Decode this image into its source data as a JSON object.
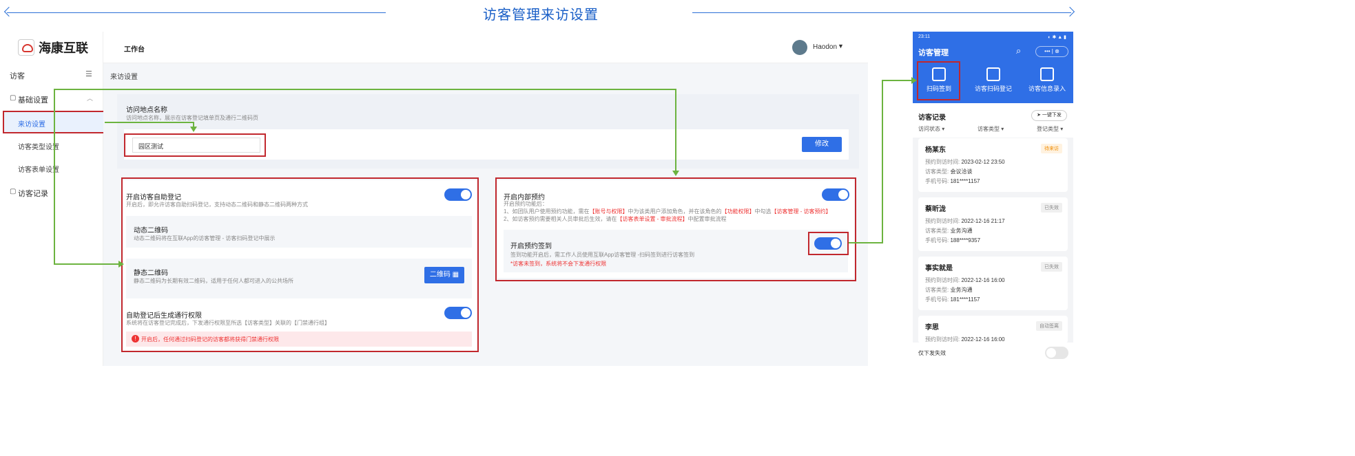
{
  "banner": {
    "title": "访客管理来访设置"
  },
  "sidebar": {
    "brand": "海康互联",
    "section_title": "访客",
    "groups": [
      {
        "label": "基础设置"
      },
      {
        "label": "访客记录"
      }
    ],
    "items": [
      {
        "label": "来访设置"
      },
      {
        "label": "访客类型设置"
      },
      {
        "label": "访客表单设置"
      }
    ]
  },
  "topbar": {
    "title": "工作台",
    "user": "Haodon"
  },
  "breadcrumb": "来访设置",
  "location": {
    "title": "访问地点名称",
    "desc": "访问地点名称，展示在访客登记填单页及通行二维码页",
    "value": "园区测试",
    "edit_label": "修改"
  },
  "self_register": {
    "title": "开启访客自助登记",
    "desc": "开启后，即允许访客自助扫码登记，支持动态二维码和静态二维码两种方式",
    "dynamic_title": "动态二维码",
    "dynamic_desc": "动态二维码将在互联App的访客管理 - 访客扫码登记中展示",
    "static_title": "静态二维码",
    "static_desc": "静态二维码为长期有效二维码，适用于任何人都可进入的公共场所",
    "qr_button": "二维码",
    "auto_title": "自助登记后生成通行权限",
    "auto_desc": "系统将在访客登记完成后，下发通行权限至所选【访客类型】关联的【门禁通行组】",
    "warning": "开启后，任何通过扫码登记的访客都将获得门禁通行权限"
  },
  "internal": {
    "title": "开启内部预约",
    "desc_intro": "开启预约功能后：",
    "desc_1a": "1、如团队用户使用预约功能，需在",
    "desc_1b": "【账号与权限】",
    "desc_1c": "中为该类用户添加角色，并在该角色的",
    "desc_1d": "【功能权限】",
    "desc_1e": "中勾选",
    "desc_1f": "【访客管理 - 访客预约】",
    "desc_2a": "2、如访客预约需要相关人员审批后生效，请在",
    "desc_2b": "【访客表单设置 - 审批流程】",
    "desc_2c": "中配置审批流程",
    "checkin_title": "开启预约签到",
    "checkin_desc": "签到功能开启后，需工作人员使用互联App访客管理 -扫码签到进行访客签到",
    "checkin_warn": "*访客未签到，系统将不会下发通行权限"
  },
  "phone": {
    "time": "23:11",
    "title": "访客管理",
    "quick_actions": [
      {
        "label": "扫码签到"
      },
      {
        "label": "访客扫码登记"
      },
      {
        "label": "访客信息录入"
      }
    ],
    "records_title": "访客记录",
    "send_all": "一键下发",
    "filters": [
      "访问状态",
      "访客类型",
      "登记类型"
    ],
    "field_labels": {
      "time": "预约到访时间:",
      "type": "访客类型:",
      "phone": "手机号码:"
    },
    "records": [
      {
        "name": "杨某东",
        "badge": "待来访",
        "time": "2023-02-12 23:50",
        "type": "会议洽谈",
        "phone": "181****1157"
      },
      {
        "name": "蔡昕泷",
        "badge": "已失效",
        "time": "2022-12-16 21:17",
        "type": "业务沟通",
        "phone": "188****9357"
      },
      {
        "name": "事实就是",
        "badge": "已失效",
        "time": "2022-12-16 16:00",
        "type": "业务沟通",
        "phone": "181****1157"
      },
      {
        "name": "李思",
        "badge": "自动签离",
        "time": "2022-12-16 16:00"
      }
    ],
    "footer": "仅下发失效"
  },
  "colors": {
    "primary": "#2f6fe6",
    "highlight": "#c1272d",
    "connector": "#6cb33f"
  }
}
